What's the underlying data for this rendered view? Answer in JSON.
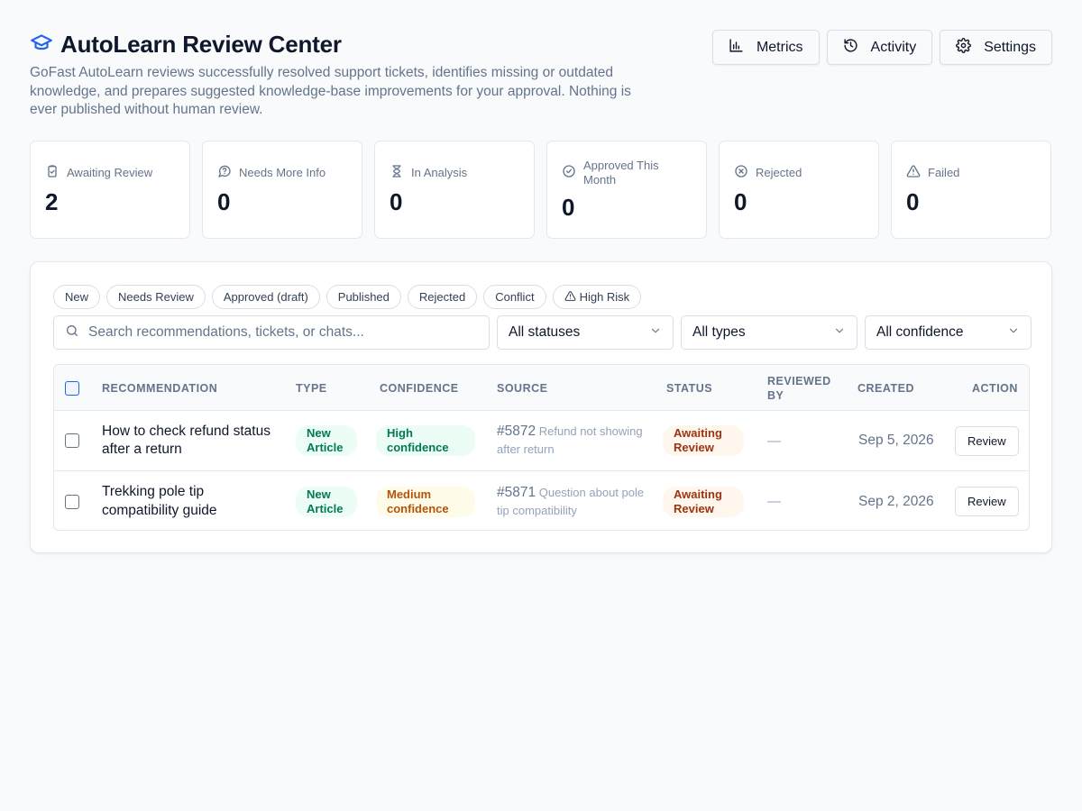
{
  "header": {
    "title": "AutoLearn Review Center",
    "subtitle": "GoFast AutoLearn reviews successfully resolved support tickets, identifies missing or outdated knowledge, and prepares suggested knowledge-base improvements for your approval. Nothing is ever published without human review.",
    "icon": "graduation-cap-icon"
  },
  "top_actions": [
    {
      "label": "Metrics",
      "icon": "bar-chart-icon"
    },
    {
      "label": "Activity",
      "icon": "history-icon"
    },
    {
      "label": "Settings",
      "icon": "gear-icon"
    }
  ],
  "stats": [
    {
      "label": "Awaiting Review",
      "value": "2",
      "icon": "clipboard-check-icon"
    },
    {
      "label": "Needs More Info",
      "value": "0",
      "icon": "question-circle-icon"
    },
    {
      "label": "In Analysis",
      "value": "0",
      "icon": "hourglass-icon"
    },
    {
      "label": "Approved This Month",
      "value": "0",
      "icon": "check-circle-icon"
    },
    {
      "label": "Rejected",
      "value": "0",
      "icon": "x-circle-icon"
    },
    {
      "label": "Failed",
      "value": "0",
      "icon": "warning-icon"
    }
  ],
  "chips": [
    "New",
    "Needs Review",
    "Approved (draft)",
    "Published",
    "Rejected",
    "Conflict",
    "High Risk"
  ],
  "filters": {
    "search_placeholder": "Search recommendations, tickets, or chats...",
    "status": "All statuses",
    "type": "All types",
    "confidence": "All confidence"
  },
  "table": {
    "columns": [
      "RECOMMENDATION",
      "TYPE",
      "CONFIDENCE",
      "SOURCE",
      "STATUS",
      "REVIEWED BY",
      "CREATED",
      "ACTION"
    ],
    "rows": [
      {
        "title": "How to check refund status after a return",
        "type": "New Article",
        "confidence": "High confidence",
        "ticket": "#5872",
        "source_text": "Refund not showing after return",
        "status": "Awaiting Review",
        "reviewed_by": "—",
        "created": "Sep 5, 2026",
        "action": "Review"
      },
      {
        "title": "Trekking pole tip compatibility guide",
        "type": "New Article",
        "confidence": "Medium confidence",
        "ticket": "#5871",
        "source_text": "Question about pole tip compatibility",
        "status": "Awaiting Review",
        "reviewed_by": "—",
        "created": "Sep 2, 2026",
        "action": "Review"
      }
    ]
  },
  "colors": {
    "accent": "#2563eb",
    "background": "#f8fafc",
    "high_confidence": "#047857",
    "medium_confidence": "#b45309",
    "awaiting_status": "#9a3412"
  }
}
